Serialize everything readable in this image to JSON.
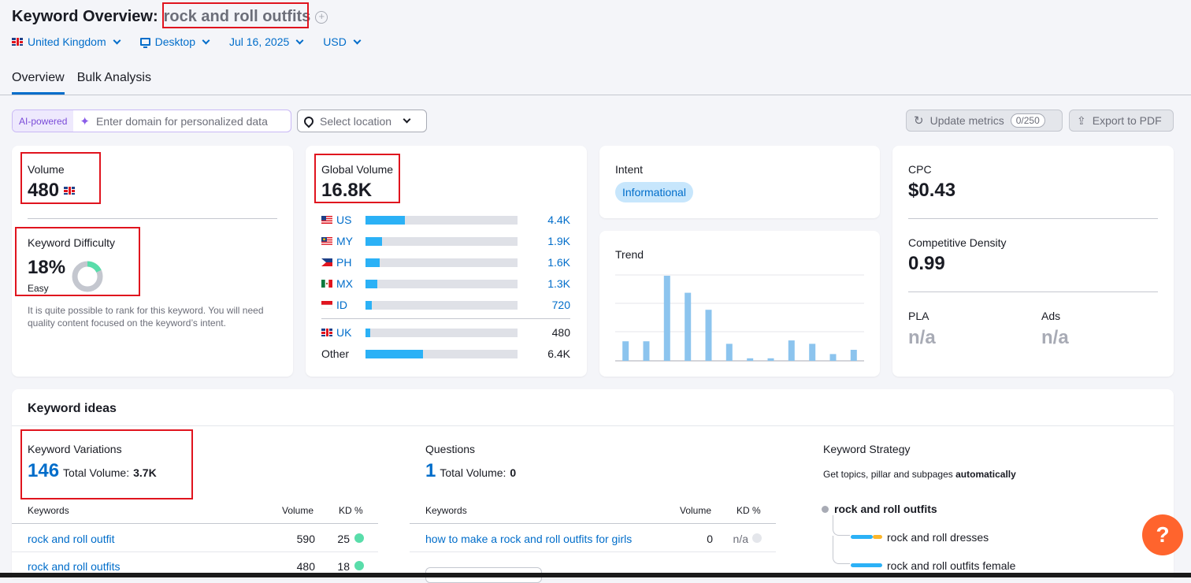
{
  "header": {
    "title_prefix": "Keyword Overview:",
    "keyword": "rock and roll outfits",
    "filters": {
      "country": "United Kingdom",
      "device": "Desktop",
      "date": "Jul 16, 2025",
      "currency": "USD"
    },
    "tabs": [
      "Overview",
      "Bulk Analysis"
    ]
  },
  "toolbar": {
    "ai_badge": "AI-powered",
    "domain_placeholder": "Enter domain for personalized data",
    "location_placeholder": "Select location",
    "update_label": "Update metrics",
    "update_counter": "0/250",
    "export_label": "Export to PDF"
  },
  "volume": {
    "label": "Volume",
    "value": "480",
    "kd_label": "Keyword Difficulty",
    "kd_value": "18%",
    "kd_level": "Easy",
    "kd_percent": 18,
    "kd_description": "It is quite possible to rank for this keyword. You will need quality content focused on the keyword’s intent."
  },
  "global_volume": {
    "label": "Global Volume",
    "value": "16.8K",
    "countries": [
      {
        "code": "US",
        "value": "4.4K",
        "fraction": 0.26
      },
      {
        "code": "MY",
        "value": "1.9K",
        "fraction": 0.11
      },
      {
        "code": "PH",
        "value": "1.6K",
        "fraction": 0.095
      },
      {
        "code": "MX",
        "value": "1.3K",
        "fraction": 0.078
      },
      {
        "code": "ID",
        "value": "720",
        "fraction": 0.043
      }
    ],
    "local": {
      "code": "UK",
      "value": "480",
      "fraction": 0.03
    },
    "other": {
      "label": "Other",
      "value": "6.4K",
      "fraction": 0.38
    }
  },
  "intent": {
    "label": "Intent",
    "value": "Informational"
  },
  "trend": {
    "label": "Trend",
    "values": [
      0.23,
      0.23,
      1.0,
      0.8,
      0.6,
      0.2,
      0.03,
      0.03,
      0.24,
      0.2,
      0.08,
      0.13
    ]
  },
  "cpc": {
    "label": "CPC",
    "value": "$0.43",
    "density_label": "Competitive Density",
    "density_value": "0.99",
    "pla_label": "PLA",
    "pla_value": "n/a",
    "ads_label": "Ads",
    "ads_value": "n/a"
  },
  "keyword_ideas": {
    "title": "Keyword ideas",
    "variations": {
      "label": "Keyword Variations",
      "count": "146",
      "total_label": "Total Volume:",
      "total_value": "3.7K",
      "col_keywords": "Keywords",
      "col_volume": "Volume",
      "col_kd": "KD %",
      "rows": [
        {
          "keyword": "rock and roll outfit",
          "volume": "590",
          "kd": "25"
        },
        {
          "keyword": "rock and roll outfits",
          "volume": "480",
          "kd": "18"
        }
      ]
    },
    "questions": {
      "label": "Questions",
      "count": "1",
      "total_label": "Total Volume:",
      "total_value": "0",
      "col_keywords": "Keywords",
      "col_volume": "Volume",
      "col_kd": "KD %",
      "rows": [
        {
          "keyword": "how to make a rock and roll outfits for girls",
          "volume": "0",
          "kd": "n/a"
        }
      ]
    },
    "strategy": {
      "label": "Keyword Strategy",
      "desc_prefix": "Get topics, pillar and subpages ",
      "desc_bold": "automatically",
      "root": "rock and roll outfits",
      "children": [
        "rock and roll dresses",
        "rock and roll outfits female"
      ]
    }
  },
  "help_label": "?",
  "colors": {
    "accent": "#006dca",
    "bar": "#2bb1f6",
    "trend": "#8cc4ee",
    "kd_easy": "#59ddaa",
    "highlight": "#e0141e",
    "help": "#ff642d"
  }
}
